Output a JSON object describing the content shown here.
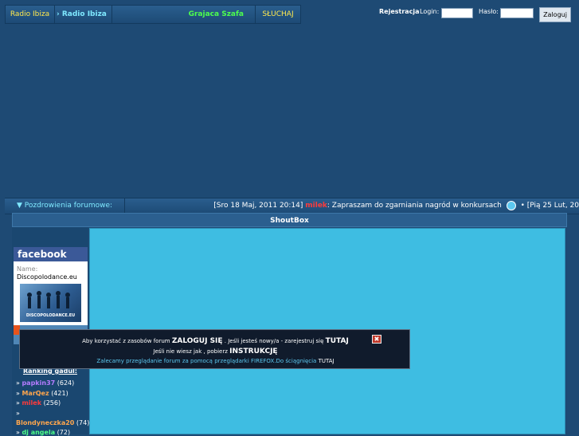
{
  "topbar": {
    "radio_ibiza": "Radio Ibiza",
    "radio_ibiza_scroller": "› Radio Ibiza",
    "grajaca_szafa": "Grajaca Szafa",
    "sluchaj": "SŁUCHAJ"
  },
  "login": {
    "register_label": "Rejestracja",
    "login_label": "Login:",
    "password_label": "Hasło:",
    "button_label": "Zaloguj"
  },
  "greetings": {
    "label": "Pozdrowienia forumowe:",
    "date1": "[Sro 18 Maj, 2011 20:14]",
    "user1": "milek",
    "message1": ": Zapraszam do zgarniania nagród w konkursach",
    "separator": "• [Pią 25 Lut, 20"
  },
  "shoutbox": {
    "title": "ShoutBox"
  },
  "facebook": {
    "brand": "facebook",
    "name_label": "Name:",
    "name_value": "Discopolodance.eu",
    "image_caption": "DISCOPOLODANCE.EU"
  },
  "ranking": {
    "title": "Ranking gadul:",
    "items": [
      {
        "bullet": "»",
        "user": "papkin37",
        "count": "(624)",
        "color": "#b57cff"
      },
      {
        "bullet": "»",
        "user": "MarQez",
        "count": "(421)",
        "color": "#ffa64d"
      },
      {
        "bullet": "»",
        "user": "milek",
        "count": "(256)",
        "color": "#ff3b3b"
      },
      {
        "bullet": "»",
        "user": "",
        "count": "",
        "color": "#ffffff"
      },
      {
        "bullet": "",
        "user": "Blondyneczka20",
        "count": "(74)",
        "color": "#ffa64d"
      },
      {
        "bullet": "»",
        "user": "dj angela",
        "count": "(72)",
        "color": "#4dff88"
      }
    ]
  },
  "popup": {
    "line1_pre": "Aby korzystać z zasobów forum",
    "line1_login": "ZALOGUJ SIĘ",
    "line1_mid": ". Jeśli jesteś nowy/a - zarejestruj się",
    "line1_here": "TUTAJ",
    "line2_pre": "Jeśli nie wiesz jak , pobierz",
    "line2_instr": "INSTRUKCJĘ",
    "line3_text": "Zalecamy przeglądanie forum za pomocą przeglądarki FIREFOX.Do ściągnięcia",
    "line3_link": "TUTAJ",
    "close_glyph": "✖"
  },
  "colors": {
    "background": "#1e4a74",
    "shoutbox_bg": "#3ebde2",
    "accent_yellow": "#ffe94d",
    "accent_cyan": "#7fe9ff",
    "accent_green": "#4dff4d"
  }
}
